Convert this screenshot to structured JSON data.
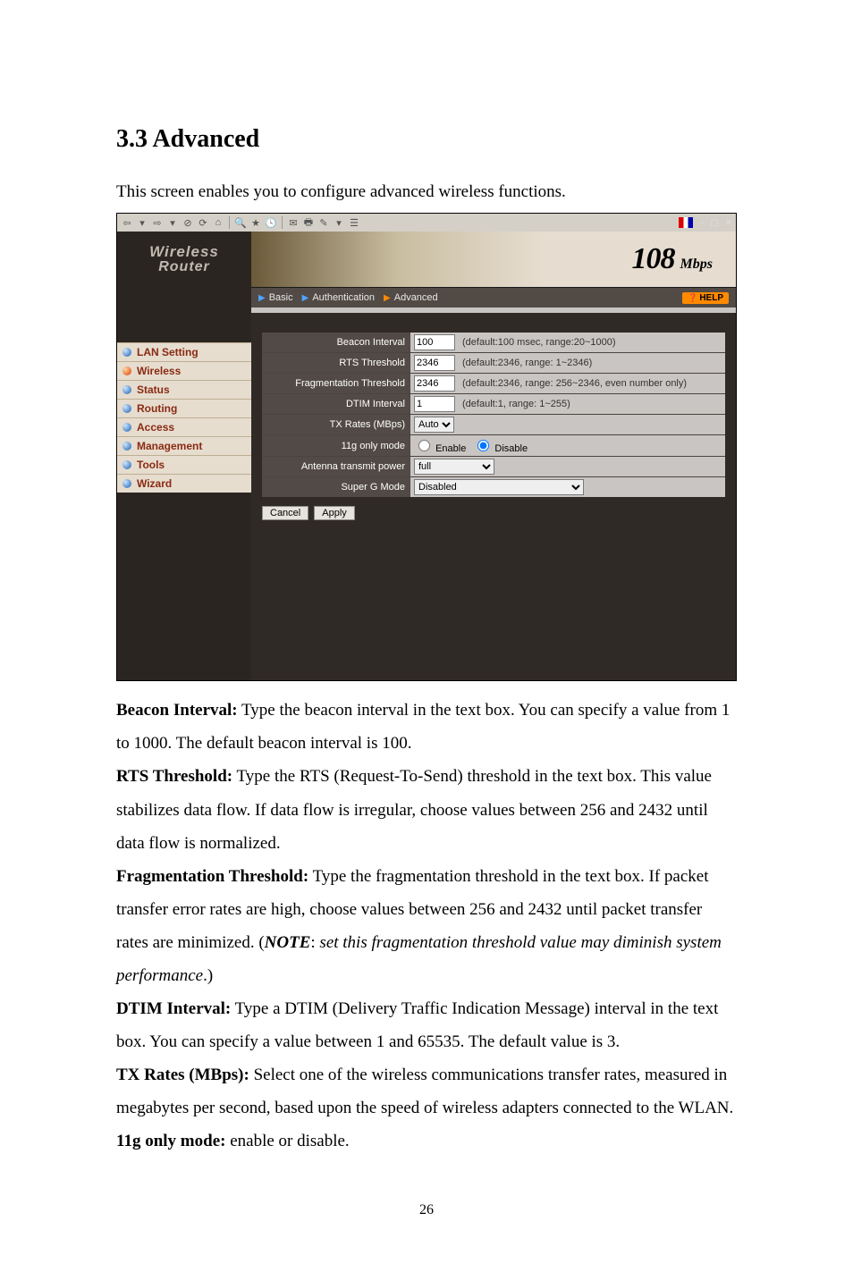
{
  "doc": {
    "section_title": "3.3 Advanced",
    "intro": "This screen enables you to configure advanced wireless functions.",
    "page_number": "26"
  },
  "screenshot": {
    "logo": {
      "line1": "Wireless",
      "line2": "Router"
    },
    "banner": {
      "big": "108",
      "small": "Mbps"
    },
    "subnav": {
      "basic": "Basic",
      "auth": "Authentication",
      "advanced": "Advanced",
      "help": "HELP"
    },
    "nav": {
      "items": [
        {
          "label": "LAN Setting"
        },
        {
          "label": "Wireless"
        },
        {
          "label": "Status"
        },
        {
          "label": "Routing"
        },
        {
          "label": "Access"
        },
        {
          "label": "Management"
        },
        {
          "label": "Tools"
        },
        {
          "label": "Wizard"
        }
      ],
      "active_index": 1
    },
    "form": {
      "beacon": {
        "label": "Beacon Interval",
        "value": "100",
        "hint": "(default:100 msec, range:20~1000)"
      },
      "rts": {
        "label": "RTS Threshold",
        "value": "2346",
        "hint": "(default:2346, range: 1~2346)"
      },
      "frag": {
        "label": "Fragmentation Threshold",
        "value": "2346",
        "hint": "(default:2346, range: 256~2346, even number only)"
      },
      "dtim": {
        "label": "DTIM Interval",
        "value": "1",
        "hint": "(default:1, range: 1~255)"
      },
      "txrates": {
        "label": "TX Rates (MBps)",
        "value": "Auto"
      },
      "g11": {
        "label": "11g only mode",
        "enable": "Enable",
        "disable": "Disable"
      },
      "ant": {
        "label": "Antenna transmit power",
        "value": "full"
      },
      "superg": {
        "label": "Super G Mode",
        "value": "Disabled"
      },
      "cancel": "Cancel",
      "apply": "Apply"
    }
  },
  "desc": {
    "beacon_h": "Beacon Interval:",
    "beacon_t": " Type the beacon interval in the text box. You can specify a value from 1 to 1000. The default beacon interval is 100.",
    "rts_h": "RTS Threshold:",
    "rts_t": " Type the RTS (Request-To-Send) threshold in the text box. This value stabilizes data flow. If data flow is irregular, choose values between 256 and 2432 until data flow is normalized.",
    "frag_h": "Fragmentation Threshold:",
    "frag_t1": " Type the fragmentation threshold in the text box. If packet transfer error rates are high, choose values between 256 and 2432 until packet transfer rates are minimized. (",
    "frag_note": "NOTE",
    "frag_t2": ": ",
    "frag_i": "set this fragmentation threshold value may diminish system performance",
    "frag_t3": ".)",
    "dtim_h": "DTIM Interval:",
    "dtim_t": " Type a DTIM (Delivery Traffic Indication Message) interval in the text box. You can specify a value between 1 and 65535. The default value is 3.",
    "tx_h": "TX Rates (MBps):",
    "tx_t": " Select one of the wireless communications transfer rates, measured in megabytes per second, based upon the speed of wireless adapters connected to the WLAN.",
    "g11_h": "11g only mode:",
    "g11_t": " enable or disable."
  }
}
